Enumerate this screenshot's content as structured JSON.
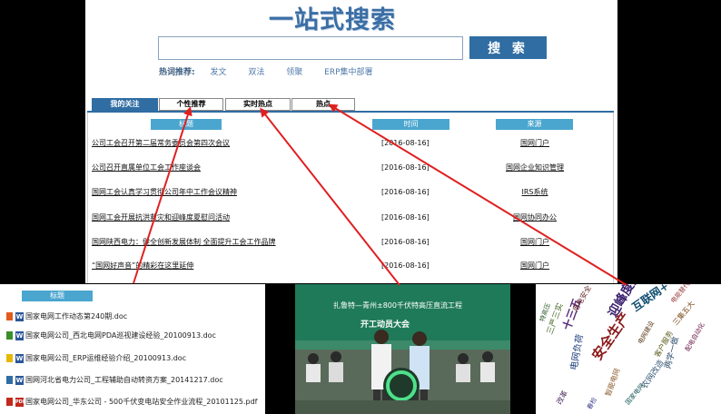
{
  "header": {
    "title": "一站式搜索"
  },
  "search": {
    "placeholder": "",
    "button_label": "搜 索"
  },
  "hot": {
    "label": "热词推荐:",
    "terms": [
      "发文",
      "双法",
      "领聚",
      "ERP集中部署"
    ]
  },
  "tabs": [
    {
      "label": "我的关注",
      "active": true
    },
    {
      "label": "个性推荐",
      "active": false
    },
    {
      "label": "实时热点",
      "active": false
    },
    {
      "label": "热点",
      "active": false
    }
  ],
  "table": {
    "headers": {
      "title": "标题",
      "time": "时间",
      "source": "来源"
    },
    "rows": [
      {
        "title": "公司工会召开第二届常务委员会第四次会议",
        "time": "[2016-08-16]",
        "source": "国网门户"
      },
      {
        "title": "公司召开直属单位工会工作座谈会",
        "time": "[2016-08-16]",
        "source": "国网企业知识管理"
      },
      {
        "title": "国网工会认真学习贯彻公司年中工作会议精神",
        "time": "[2016-08-16]",
        "source": "IRS系统"
      },
      {
        "title": "国网工会开展抗洪救灾和迎峰度夏慰问活动",
        "time": "[2016-08-16]",
        "source": "国网协同办公"
      },
      {
        "title": "国网陕西电力：健全创新发展体制 全面提升工会工作品牌",
        "time": "[2016-08-16]",
        "source": "国网门户"
      },
      {
        "title": "“国网好声音”的精彩在这里延伸",
        "time": "[2016-08-16]",
        "source": "国网门户"
      }
    ]
  },
  "docs": {
    "header": "标题",
    "rows": [
      {
        "name": "国家电网工作动态第240期.doc",
        "type": "W",
        "indicator_color": "#e25a1c"
      },
      {
        "name": "国家电网公司_西北电网PDA巡视建设经验_20100913.doc",
        "type": "W",
        "indicator_color": "#3a8f2b"
      },
      {
        "name": "国家电网公司_ERP运维经验介绍_20100913.doc",
        "type": "W",
        "indicator_color": "#e6b800"
      },
      {
        "name": "国网河北省电力公司_工程辅助自动转资方案_20141217.doc",
        "type": "W",
        "indicator_color": "#2f6da3"
      },
      {
        "name": "国家电网公司_华东公司 - 500千伏变电站安全作业流程_20101125.pdf",
        "type": "PDF",
        "indicator_color": "#c2281c"
      }
    ]
  },
  "photo": {
    "banner_line1": "扎鲁特—青州±800千伏特高压直流工程",
    "banner_line2": "开工动员大会"
  },
  "cloud": {
    "words": [
      {
        "text": "安全生产",
        "color": "#8b1a1a"
      },
      {
        "text": "迎峰度夏",
        "color": "#3a1f6e"
      },
      {
        "text": "互联网+",
        "color": "#0f4c6e"
      },
      {
        "text": "十三五",
        "color": "#5a2a7a"
      },
      {
        "text": "三严三实",
        "color": "#4a6b2a"
      },
      {
        "text": "电网负荷",
        "color": "#1c3f7a"
      },
      {
        "text": "用电安全",
        "color": "#6a2f2f"
      },
      {
        "text": "三集五大",
        "color": "#7a4a1a"
      },
      {
        "text": "两学一做",
        "color": "#2a4a6a"
      },
      {
        "text": "客户服务",
        "color": "#5a5a1a"
      },
      {
        "text": "电能替代",
        "color": "#9a3a3a"
      },
      {
        "text": "特高压",
        "color": "#2f5f2f"
      },
      {
        "text": "改革",
        "color": "#4a2a5a"
      },
      {
        "text": "农网改造",
        "color": "#3a5a7a"
      },
      {
        "text": "配电自动化",
        "color": "#6a1a4a"
      },
      {
        "text": "国家电网",
        "color": "#1a5a5a"
      },
      {
        "text": "智能电网",
        "color": "#8a5a2a"
      },
      {
        "text": "春检",
        "color": "#3a3a8a"
      },
      {
        "text": "电网建设",
        "color": "#5a3a1a"
      }
    ]
  },
  "colors": {
    "brand": "#2f6da3",
    "header_cell": "#4aa6cf",
    "arrow": "#e02020"
  }
}
